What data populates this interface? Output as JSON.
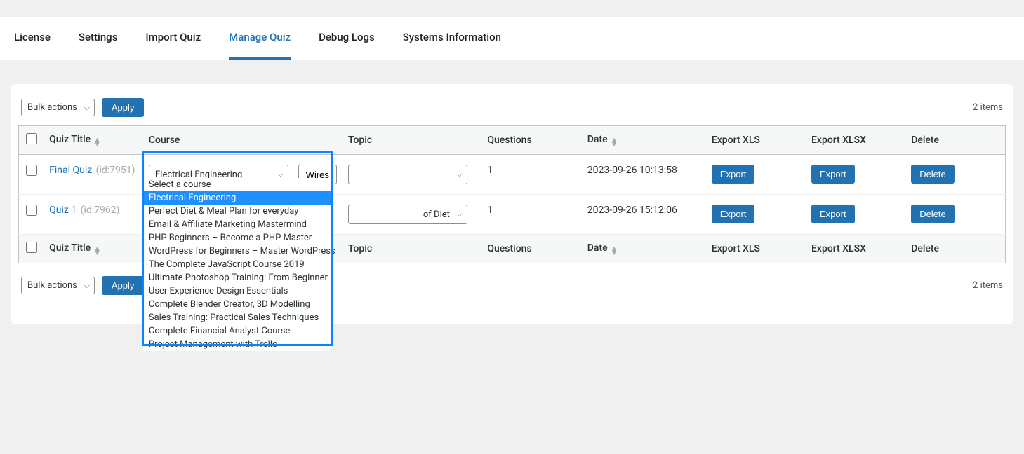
{
  "tabs": [
    "License",
    "Settings",
    "Import Quiz",
    "Manage Quiz",
    "Debug Logs",
    "Systems Information"
  ],
  "activeTabIndex": 3,
  "bulkSelect": "Bulk actions",
  "applyLabel": "Apply",
  "itemsCount": "2 items",
  "columns": {
    "title": "Quiz Title",
    "course": "Course",
    "topic": "Topic",
    "questions": "Questions",
    "date": "Date",
    "xls": "Export XLS",
    "xlsx": "Export XLSX",
    "delete": "Delete"
  },
  "rows": [
    {
      "title": "Final Quiz",
      "id": "(id:7951)",
      "courseSelected": "Electrical Engineering",
      "wiresLabel": "Wires",
      "topicSelected": "",
      "questions": "1",
      "date": "2023-09-26 10:13:58",
      "exportLabel": "Export",
      "deleteLabel": "Delete",
      "dropdownOpen": true
    },
    {
      "title": "Quiz 1",
      "id": "(id:7962)",
      "courseSelected": "",
      "topicSelected": "of Diet",
      "questions": "1",
      "date": "2023-09-26 15:12:06",
      "exportLabel": "Export",
      "deleteLabel": "Delete",
      "dropdownOpen": false
    }
  ],
  "dropdownOptions": [
    "Select a course",
    "Electrical Engineering",
    "Perfect Diet & Meal Plan for everyday",
    "Email & Affiliate Marketing Mastermind",
    "PHP Beginners – Become a PHP Master",
    "WordPress for Beginners – Master WordPress",
    "The Complete JavaScript Course 2019",
    "Ultimate Photoshop Training: From Beginner",
    "User Experience Design Essentials",
    "Complete Blender Creator, 3D Modelling",
    "Sales Training: Practical Sales Techniques",
    "Complete Financial Analyst Course",
    "Project Management with Trello"
  ],
  "dropdownSelectedIndex": 1
}
